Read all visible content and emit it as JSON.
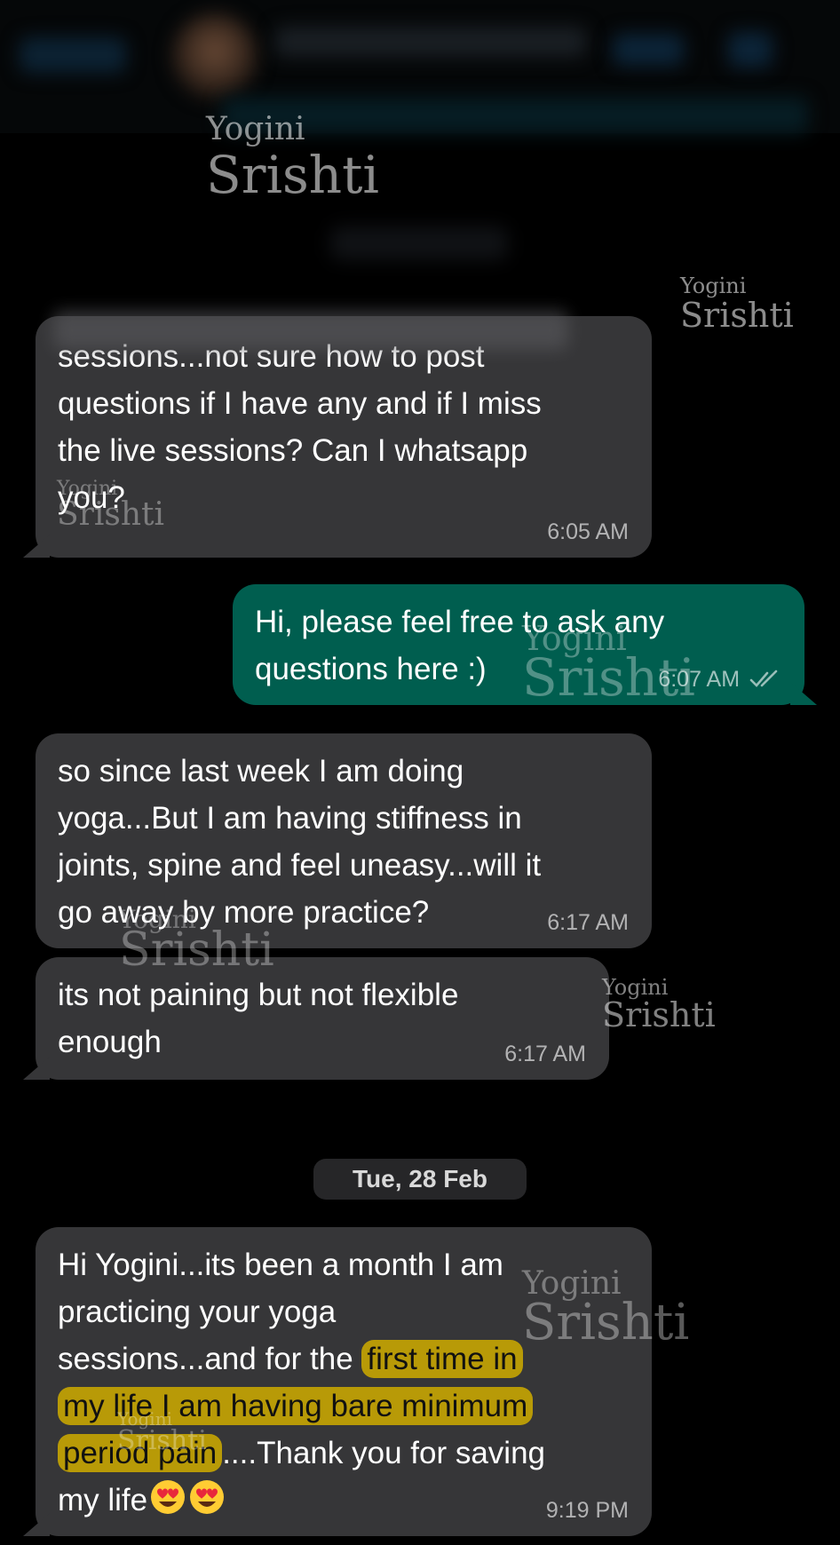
{
  "watermark": {
    "line1": "Yogini",
    "line2": "Srishti"
  },
  "messages": [
    {
      "direction": "incoming",
      "lines": [
        "sessions...not sure how to post",
        "questions if I have any and if I miss",
        "the live sessions? Can I whatsapp",
        "you?"
      ],
      "time": "6:05 AM"
    },
    {
      "direction": "outgoing",
      "lines": [
        "Hi, please feel free to ask any",
        "questions here :)"
      ],
      "time": "6:07 AM",
      "status_icon": "double-check-icon"
    },
    {
      "direction": "incoming",
      "lines": [
        "so since last week I am doing",
        "yoga...But I am having stiffness in",
        "joints, spine and feel uneasy...will it",
        "go away by more practice?"
      ],
      "time": "6:17 AM"
    },
    {
      "direction": "incoming",
      "lines": [
        "its not paining but not flexible",
        "enough"
      ],
      "time": "6:17 AM"
    },
    {
      "direction": "incoming",
      "line1": "Hi Yogini...its been a month I am",
      "line2": "practicing your yoga",
      "line3_plain": "sessions...and for the ",
      "line3_highlight": "first time in",
      "line4_highlight": "my life I am having bare minimum",
      "line5_highlight": "period pain",
      "line5_plain": "....Thank you for saving",
      "line6": "my life",
      "emojis": [
        "heart-eyes-emoji",
        "heart-eyes-emoji"
      ],
      "time": "9:19 PM"
    }
  ],
  "date_separator": "Tue, 28 Feb",
  "colors": {
    "background": "#000000",
    "incoming_bubble": "#363638",
    "outgoing_bubble": "#005e4f",
    "highlight": "#b89a07"
  }
}
